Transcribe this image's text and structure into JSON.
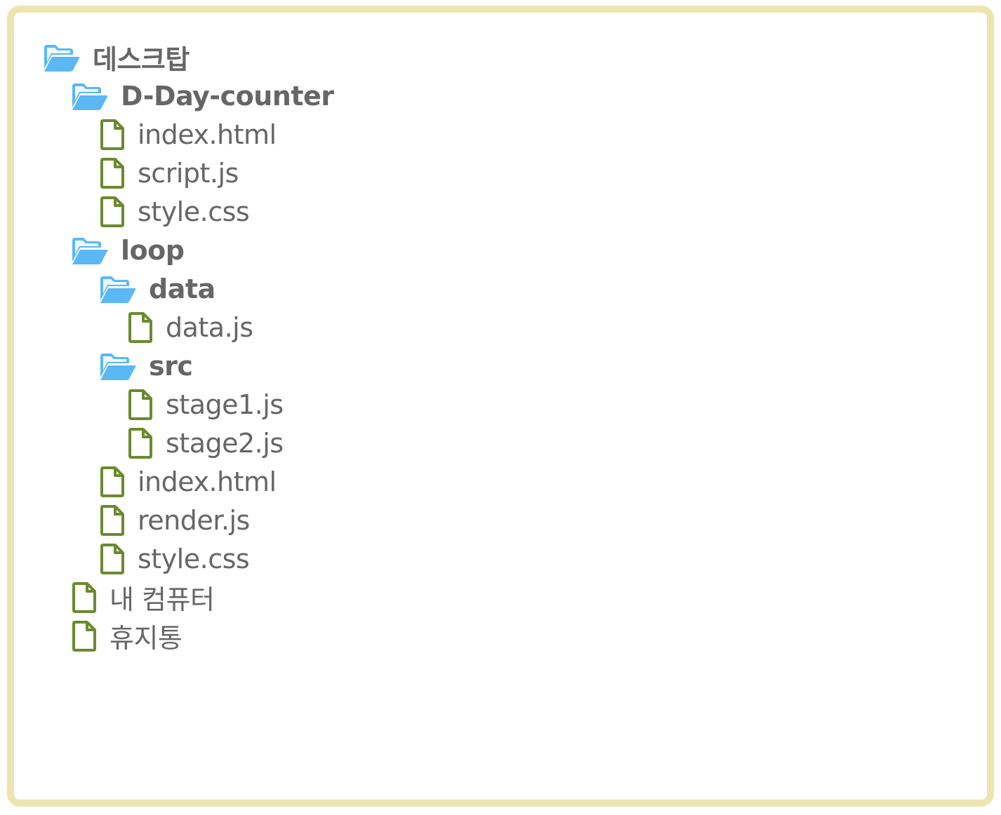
{
  "colors": {
    "frame_border": "#ede5b0",
    "folder_icon": "#5bb8f5",
    "file_icon": "#6b8a2f",
    "text": "#666666"
  },
  "tree": {
    "root": {
      "label": "데스크탑",
      "icon": "folder-open-icon"
    },
    "dday_folder": {
      "label": "D-Day-counter",
      "icon": "folder-open-icon"
    },
    "dday_index": {
      "label": "index.html",
      "icon": "file-icon"
    },
    "dday_script": {
      "label": "script.js",
      "icon": "file-icon"
    },
    "dday_style": {
      "label": "style.css",
      "icon": "file-icon"
    },
    "loop_folder": {
      "label": "loop",
      "icon": "folder-open-icon"
    },
    "data_folder": {
      "label": "data",
      "icon": "folder-open-icon"
    },
    "data_js": {
      "label": "data.js",
      "icon": "file-icon"
    },
    "src_folder": {
      "label": "src",
      "icon": "folder-open-icon"
    },
    "stage1": {
      "label": "stage1.js",
      "icon": "file-icon"
    },
    "stage2": {
      "label": "stage2.js",
      "icon": "file-icon"
    },
    "loop_index": {
      "label": "index.html",
      "icon": "file-icon"
    },
    "loop_render": {
      "label": "render.js",
      "icon": "file-icon"
    },
    "loop_style": {
      "label": "style.css",
      "icon": "file-icon"
    },
    "my_computer": {
      "label": "내 컴퓨터",
      "icon": "file-icon"
    },
    "trash": {
      "label": "휴지통",
      "icon": "file-icon"
    }
  }
}
